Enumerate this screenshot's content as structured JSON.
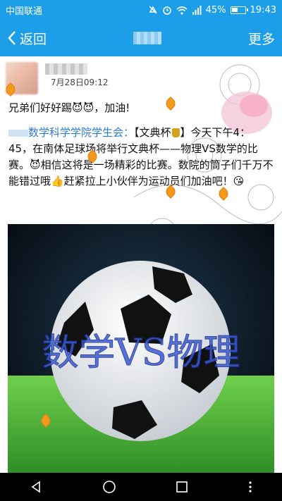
{
  "status_bar": {
    "carrier": "中国联通",
    "battery": "45%",
    "time": "19:43"
  },
  "nav": {
    "back_label": "返回",
    "more_label": "更多"
  },
  "post": {
    "time": "7月28日09:12",
    "text": "兄弟们好好踢😈😈，加油!",
    "quote_author": "数学科学学院学生会：",
    "quote_part1": "【文典杯",
    "quote_part2": "】今天下午4：45，在南体足球场将举行文典杯——物理VS数学的比赛。😈相信这将是一场精彩的比赛。数院的筒子们千万不能错过哦👍赶紧拉上小伙伴为运动员们加油吧！😘",
    "photo_caption": "数学VS物理"
  }
}
